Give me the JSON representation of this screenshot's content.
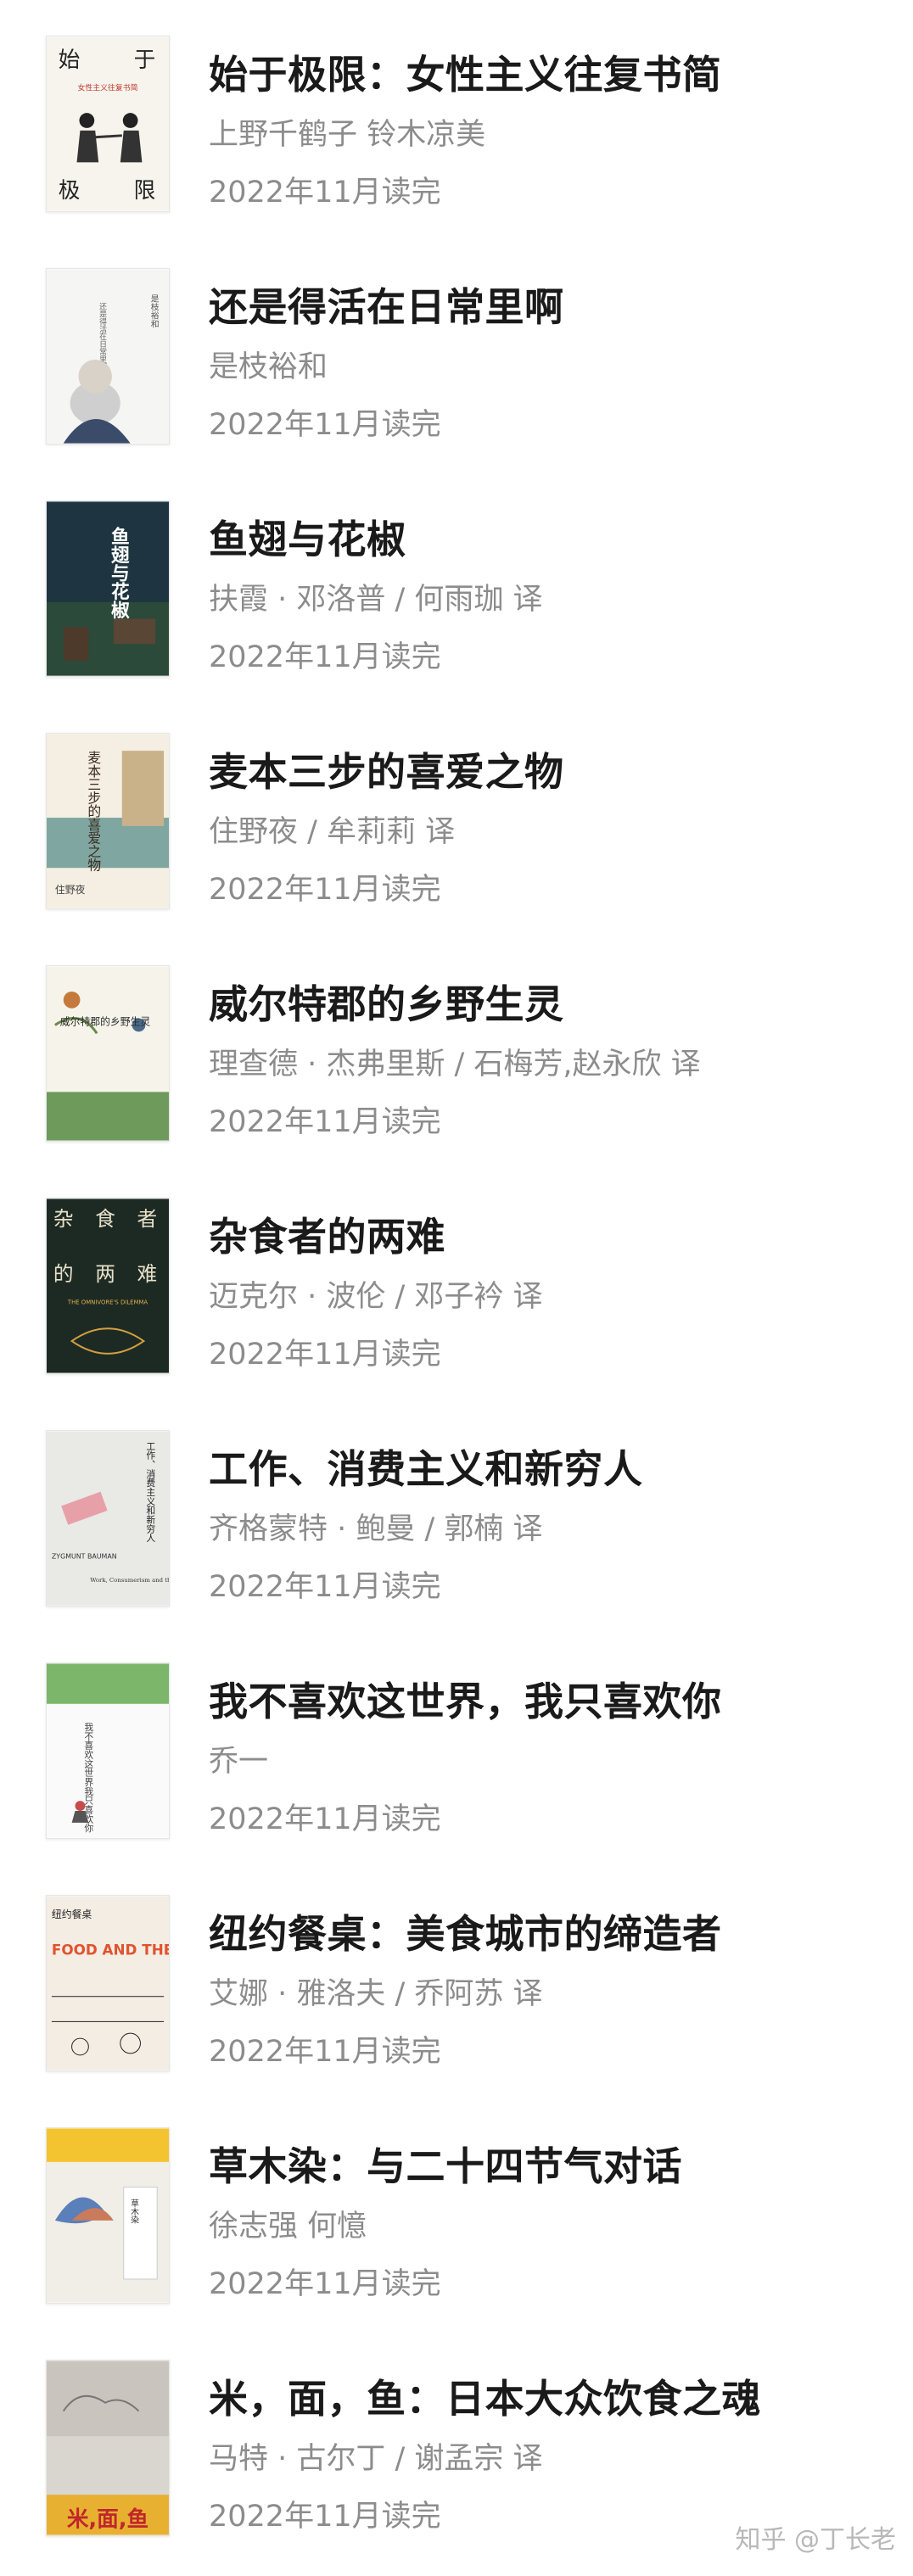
{
  "books": [
    {
      "title": "始于极限：女性主义往复书简",
      "author": "上野千鹤子 铃木凉美",
      "status": "2022年11月读完"
    },
    {
      "title": "还是得活在日常里啊",
      "author": "是枝裕和",
      "status": "2022年11月读完"
    },
    {
      "title": "鱼翅与花椒",
      "author": "扶霞 · 邓洛普 / 何雨珈 译",
      "status": "2022年11月读完"
    },
    {
      "title": "麦本三步的喜爱之物",
      "author": "住野夜 / 牟莉莉 译",
      "status": "2022年11月读完"
    },
    {
      "title": "威尔特郡的乡野生灵",
      "author": "理查德 · 杰弗里斯 / 石梅芳,赵永欣 译",
      "status": "2022年11月读完"
    },
    {
      "title": "杂食者的两难",
      "author": "迈克尔 · 波伦 / 邓子衿 译",
      "status": "2022年11月读完"
    },
    {
      "title": "工作、消费主义和新穷人",
      "author": "齐格蒙特 · 鲍曼 / 郭楠 译",
      "status": "2022年11月读完"
    },
    {
      "title": "我不喜欢这世界，我只喜欢你",
      "author": "乔一",
      "status": "2022年11月读完"
    },
    {
      "title": "纽约餐桌：美食城市的缔造者",
      "author": "艾娜 · 雅洛夫 / 乔阿苏 译",
      "status": "2022年11月读完"
    },
    {
      "title": "草木染：与二十四节气对话",
      "author": "徐志强 何憶",
      "status": "2022年11月读完"
    },
    {
      "title": "米，面，鱼：日本大众饮食之魂",
      "author": "马特 · 古尔丁 / 谢孟宗 译",
      "status": "2022年11月读完"
    }
  ],
  "covers": [
    {
      "texts": [
        "始",
        "于",
        "极",
        "限",
        "女性主义往复书简"
      ]
    },
    {
      "texts": [
        "还是得活在日常里啊",
        "是枝裕和"
      ]
    },
    {
      "texts": [
        "鱼翅与花椒"
      ]
    },
    {
      "texts": [
        "麦本三步的喜爱之物",
        "住野夜"
      ]
    },
    {
      "texts": [
        "威尔特郡的乡野生灵"
      ]
    },
    {
      "texts": [
        "杂",
        "食",
        "者",
        "的",
        "两",
        "难",
        "THE OMNIVORE'S DILEMMA"
      ]
    },
    {
      "texts": [
        "工作、消费主义和新穷人",
        "ZYGMUNT BAUMAN",
        "Work, Consumerism and the New Poor"
      ]
    },
    {
      "texts": [
        "我不喜欢这世界我只喜欢你"
      ]
    },
    {
      "texts": [
        "纽约餐桌",
        "FOOD AND THE CITY"
      ]
    },
    {
      "texts": [
        "草木染"
      ]
    },
    {
      "texts": [
        "米,面,鱼"
      ]
    }
  ],
  "watermark": "知乎 @丁长老"
}
